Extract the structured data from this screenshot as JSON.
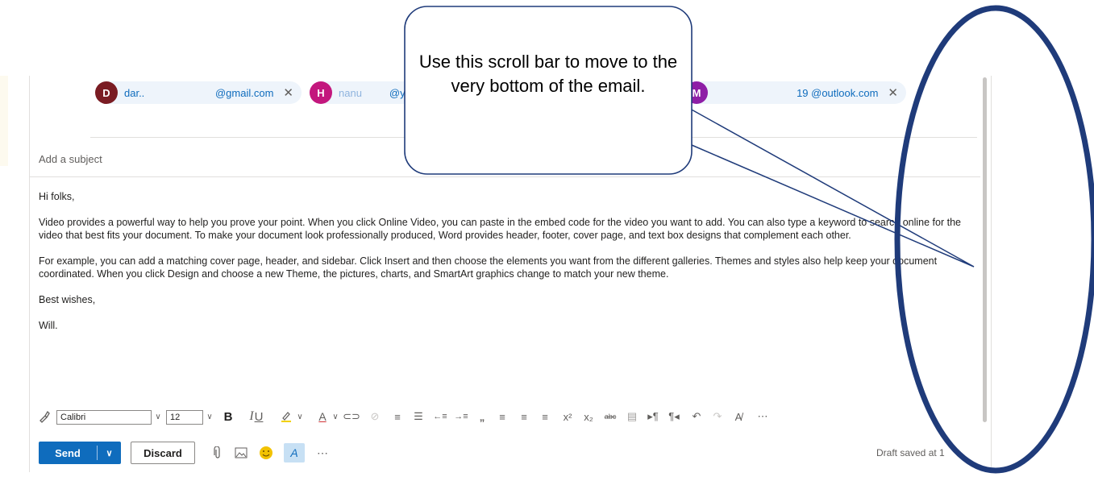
{
  "recipients": [
    {
      "initial": "D",
      "name": "dar..",
      "email": "@gmail.com",
      "color": "#7a1c23"
    },
    {
      "initial": "H",
      "name": "nanu",
      "email": "@y",
      "color": "#c3177d"
    },
    {
      "initial": "M",
      "name": "",
      "email": "19  @outlook.com",
      "color": "#8e1ea6"
    }
  ],
  "subject": {
    "placeholder": "Add a subject"
  },
  "body": {
    "greeting": "Hi folks,",
    "paragraph1": "Video provides a powerful way to help you prove your point. When you click Online Video, you can paste in the embed code for the video you want to add. You can also type a keyword to search online for the video that best fits your document. To make your document look professionally produced, Word provides header, footer, cover page, and text box designs that complement each other.",
    "paragraph2": "For example, you can add a matching cover page, header, and sidebar. Click Insert and then choose the elements you want from the different galleries. Themes and styles also help keep your document coordinated. When you click Design and choose a new Theme, the pictures, charts, and SmartArt graphics change to match your new theme.",
    "closing": "Best wishes,",
    "signature": "Will."
  },
  "format_toolbar": {
    "font_name": "Calibri",
    "font_size": "12",
    "icons": {
      "format_painter": "brush-icon",
      "bold": "B",
      "italic": "I",
      "underline": "U",
      "more": "⋯"
    }
  },
  "actions": {
    "send_label": "Send",
    "discard_label": "Discard",
    "more": "⋯",
    "draft_status": "Draft saved at 1"
  },
  "callout": {
    "text": "Use this scroll bar to move to the very bottom of the email."
  },
  "colors": {
    "accent": "#0f6cbd",
    "annotation": "#1f3b7a"
  }
}
